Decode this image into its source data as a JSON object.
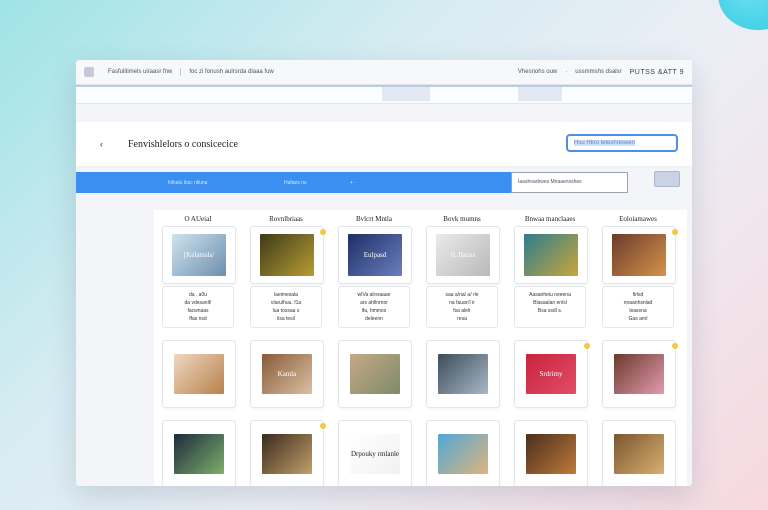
{
  "titlebar": {
    "left_text_1": "Fasfulitimels uiraasr fnw",
    "left_text_2": "foc zi fonush aulrsrda dlaaa fuw",
    "right_text_1": "Vhesnohs ouw",
    "right_text_2": "ussmmshs dsalsr",
    "right_text_3": "PUTSS &ATT 9",
    "right_dot": "·"
  },
  "header": {
    "back_icon": "‹",
    "title": "Fenvishlelors o consicecice",
    "search_value": "Hsu Hkro leteshreseen"
  },
  "bluebar": {
    "item_1": "folkalu ibsc nlluna",
    "item_2": "Hafaes ns",
    "item_3": "+ ·"
  },
  "filter": {
    "value": "Iaashoarbwes Mnaaensshes"
  },
  "columns": [
    {
      "header": "O AUeiaI"
    },
    {
      "header": "Rovnlbriaas"
    },
    {
      "header": "Bvlcrt Mntla"
    },
    {
      "header": "Bovk mumns"
    },
    {
      "header": "Bnwaa manclaaes"
    },
    {
      "header": "Eoloiamawes"
    }
  ],
  "row1_thumbs": [
    {
      "text": "[Kelamsls/",
      "colors": [
        "#cfe3ef",
        "#6d8fae"
      ]
    },
    {
      "text": "",
      "colors": [
        "#3d3a1a",
        "#b99d32"
      ]
    },
    {
      "text": "Eulpasd",
      "colors": [
        "#1d2f66",
        "#6b7fbf"
      ]
    },
    {
      "text": "lL Ilacns",
      "colors": [
        "#eaeaea",
        "#b9b9b9"
      ]
    },
    {
      "text": "",
      "colors": [
        "#2e7d8d",
        "#c8a63a"
      ]
    },
    {
      "text": "",
      "colors": [
        "#6a3b2a",
        "#d7934d"
      ]
    }
  ],
  "row1_labels": [
    {
      "lines": [
        "da . a0u",
        "da vdesanlt!",
        "facwnaas",
        "ffas nsd"
      ]
    },
    {
      "lines": [
        "laeimesala",
        "vIarulhuu. f1a",
        "lua tossaa s",
        "lisa tesil"
      ]
    },
    {
      "lines": [
        "wIVa alrsraaae",
        "ars ahllnrnor",
        "lfa, hmmos",
        "deleenn"
      ]
    },
    {
      "lines": [
        "saa a/na/ a/ rle",
        "na fauan'l ir",
        "fsa alelr",
        "resa"
      ]
    },
    {
      "lines": [
        "Aasanheiu neeena",
        "Blasaalan enlsl",
        "Bsa ssdl s.",
        ""
      ]
    },
    {
      "lines": [
        "firlsd",
        "nnaanhsnlad",
        "leassna",
        "Gas arnl"
      ]
    }
  ],
  "row2_thumbs": [
    {
      "text": "",
      "colors": [
        "#f0d7c2",
        "#b8814b"
      ]
    },
    {
      "text": "Kamla",
      "colors": [
        "#8a5a3a",
        "#d9c1a1"
      ]
    },
    {
      "text": "",
      "colors": [
        "#c5a985",
        "#7e8a6a"
      ]
    },
    {
      "text": "",
      "colors": [
        "#3d4c5a",
        "#a9b8c6"
      ]
    },
    {
      "text": "Srdrimy",
      "colors": [
        "#c8243e",
        "#e24d66"
      ]
    },
    {
      "text": "",
      "colors": [
        "#6b3a2c",
        "#e39ab0"
      ]
    }
  ],
  "row3_thumbs": [
    {
      "text": "",
      "colors": [
        "#1f2a3c",
        "#7ab06b"
      ]
    },
    {
      "text": "",
      "colors": [
        "#3a2b1e",
        "#c2a06a"
      ]
    },
    {
      "text": "Drpouky rmlanle",
      "colors": [
        "#ffffff",
        "#f1f1f1"
      ]
    },
    {
      "text": "",
      "colors": [
        "#4fa8d6",
        "#e0b47c"
      ]
    },
    {
      "text": "",
      "colors": [
        "#4a2e1c",
        "#c07a3c"
      ]
    },
    {
      "text": "",
      "colors": [
        "#7a5530",
        "#d9b070"
      ]
    }
  ],
  "colors": {
    "accent": "#3a8ff0",
    "search_border": "#4f8cf0",
    "pin": "#f2c744"
  }
}
